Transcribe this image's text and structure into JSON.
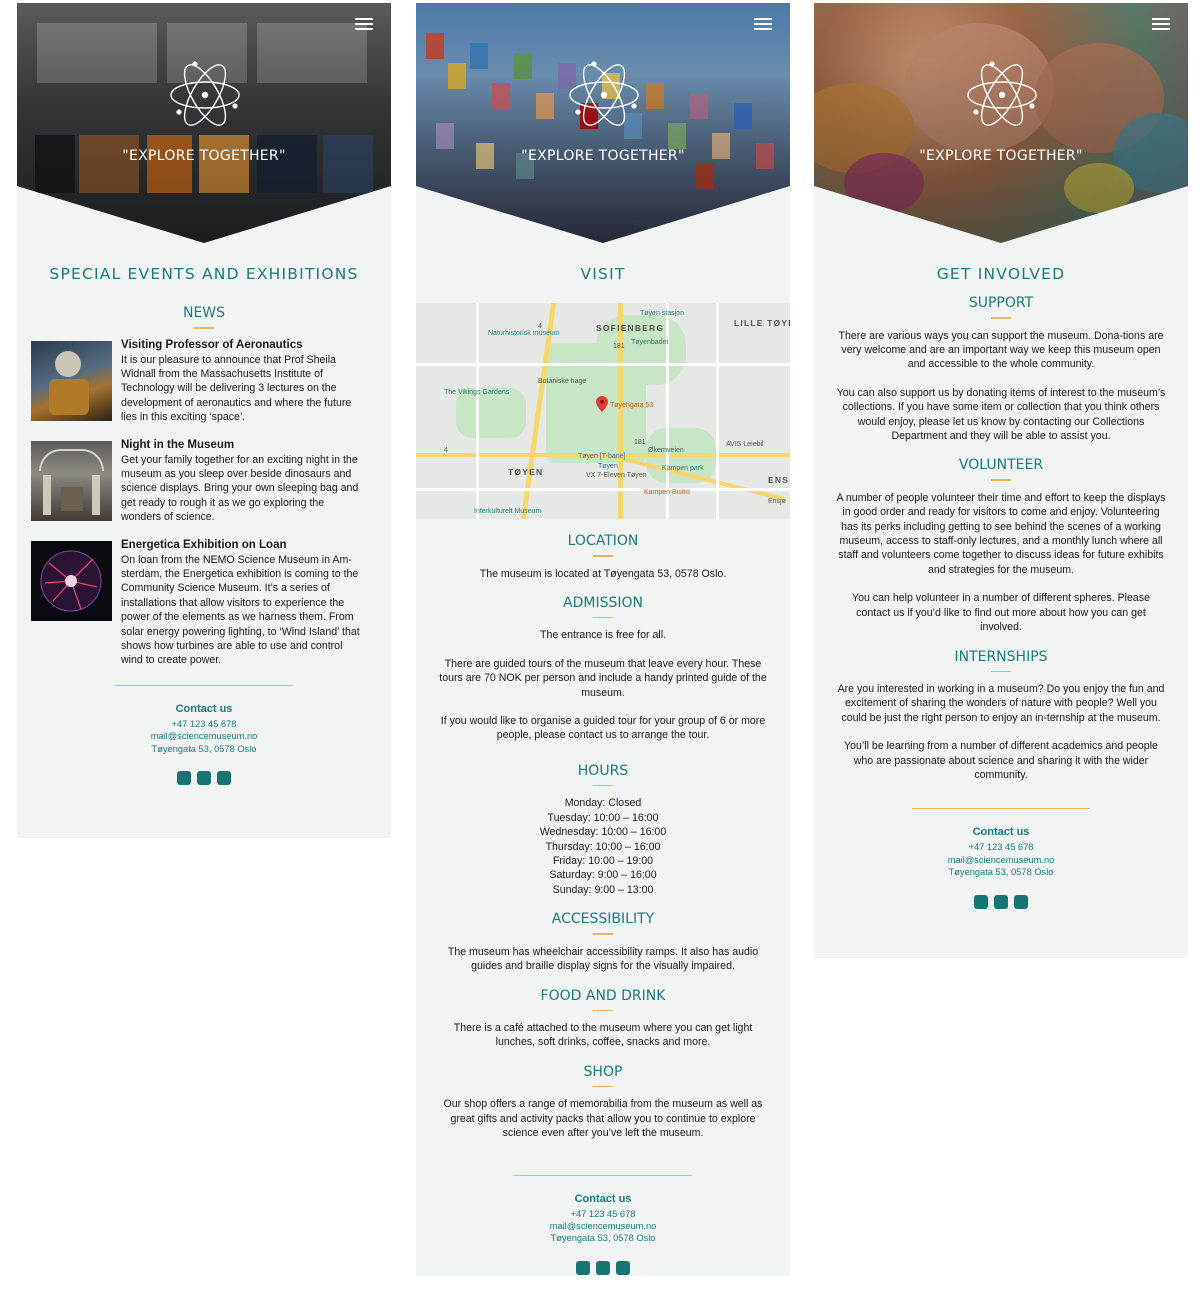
{
  "hero": {
    "tagline": "\"EXPLORE TOGETHER\""
  },
  "news_screen": {
    "page_title": "SPECIAL EVENTS AND EXHIBITIONS",
    "section_title": "NEWS",
    "items": [
      {
        "heading": "Visiting Professor of Aeronautics",
        "body": "It is our pleasure to announce that Prof Sheila Widnall from the Massachusetts Institute of Technology will be delivering 3 lectures on the development of aeronautics and where the future lies in this exciting ‘space’."
      },
      {
        "heading": "Night in the Museum",
        "body": "Get your family together for an exciting night in the museum as you sleep over beside dinosaurs and science displays. Bring your own sleeping bag and get ready to rough it as we go exploring the wonders of science."
      },
      {
        "heading": "Energetica Exhibition on Loan",
        "body": "On loan from the NEMO Science Museum in Am-sterdam, the Energetica exhibition is coming to the Community Science Museum. It’s a series of installations that allow visitors to experience the power of the elements as we harness them. From solar energy powering lighting, to ‘Wind Island’ that shows how turbines are able to use and control wind to create power."
      }
    ],
    "contact": {
      "title": "Contact us",
      "phone": "+47 123 45 678",
      "email": "mail@sciencemuseum.no",
      "address": "Tøyengata 53, 0578 Oslo"
    }
  },
  "visit_screen": {
    "page_title": "VISIT",
    "map": {
      "labels": {
        "toyen_stasjon": "Tøyen stasjon",
        "naturhistorisk": "Naturhistorisk museum",
        "sofienberg": "SOFIENBERG",
        "lille_toyen": "LILLE TØYEN",
        "toyenbadet": "Tøyenbadet",
        "botaniske": "Botaniske hage",
        "vikings": "The Vikings Gardens",
        "pin_label": "Tøyengata 53",
        "avis": "AVIS Leiebil",
        "toyen_fbane": "Tøyen [T-bane]",
        "toyen_small": "Tøyen",
        "vx": "VX 7-Eleven Tøyen",
        "okern": "Økernveien",
        "kampen_park": "Kampen park",
        "toyen": "TØYEN",
        "kampen_bistro": "Kampen Bistro",
        "interkulturelt": "Interkulturelt Museum",
        "ens": "ENS",
        "ensjo": "Ensjø",
        "road_181": "181",
        "road_4": "4"
      }
    },
    "sections": [
      {
        "title": "LOCATION",
        "paragraphs": [
          "The museum is located at Tøyengata 53, 0578 Oslo."
        ]
      },
      {
        "title": "ADMISSION",
        "paragraphs": [
          "The entrance is free for all.",
          "There are guided tours of the museum that leave every hour. These tours are 70 NOK per person and include a handy printed guide of the museum.",
          "If you would like to organise a guided tour for your group of 6 or more people, please contact us to arrange the tour."
        ]
      },
      {
        "title": "HOURS",
        "paragraphs": [
          "Monday: Closed\nTuesday: 10:00 – 16:00\nWednesday: 10:00 – 16:00\nThursday: 10:00 – 16:00\nFriday: 10:00 – 19:00\nSaturday: 9:00 – 16:00\nSunday: 9:00 – 13:00"
        ]
      },
      {
        "title": "ACCESSIBILITY",
        "paragraphs": [
          "The museum has wheelchair accessibility ramps. It also has audio guides and braille display signs for the visually impaired."
        ]
      },
      {
        "title": "FOOD AND DRINK",
        "paragraphs": [
          "There is a café attached to the museum where you can get light lunches, soft drinks, coffee, snacks and more."
        ]
      },
      {
        "title": "SHOP",
        "paragraphs": [
          "Our shop offers a range of memorabilia from the museum as well as great gifts and activity packs that allow you to continue to explore science even after you’ve left the museum."
        ]
      }
    ],
    "contact": {
      "title": "Contact us",
      "phone": "+47 123 45 678",
      "email": "mail@sciencemuseum.no",
      "address": "Tøyengata 53, 0578 Oslo"
    }
  },
  "involve_screen": {
    "page_title": "GET INVOLVED",
    "sections": [
      {
        "title": "SUPPORT",
        "paragraphs": [
          "There are various ways you can support the museum. Dona-tions are very welcome and are an important way we keep this museum open and accessible to the whole community.",
          "You can also support us by donating items of interest to the museum’s collections. If you have some item or collection that you think others would enjoy, please let us know by contacting our Collections Department and they will be able to assist you."
        ]
      },
      {
        "title": "VOLUNTEER",
        "paragraphs": [
          "A number of people volunteer their time and effort to keep the displays in good order and ready for visitors to come and enjoy. Volunteering has its perks including getting to see behind the scenes of a working museum, access to staff-only lectures, and a monthly lunch where all staff and volunteers come together to discuss ideas for future exhibits and strategies for the museum.",
          "You can help volunteer in a number of different spheres. Please contact us if you’d like to find out more about how you can get involved."
        ]
      },
      {
        "title": "INTERNSHIPS",
        "paragraphs": [
          "Are you interested in working in a museum? Do you enjoy the fun and excitement of sharing the wonders of nature with people? Well you could be just the right person to enjoy an in-ternship at the museum.",
          "You’ll be learning from a number of different academics and people who are passionate about science and sharing it with the wider community."
        ]
      }
    ],
    "contact": {
      "title": "Contact us",
      "phone": "+47 123 45 678",
      "email": "mail@sciencemuseum.no",
      "address": "Tøyengata 53, 0578 Oslo"
    }
  },
  "colors": {
    "teal": "#1b7a7a",
    "accent": "#e8b458",
    "background": "#f2f4f4",
    "social": "#167573"
  },
  "icons": {
    "menu": "hamburger-menu-icon",
    "logo": "atom-logo-icon",
    "social": "social-icon",
    "map_pin": "map-pin-icon"
  }
}
